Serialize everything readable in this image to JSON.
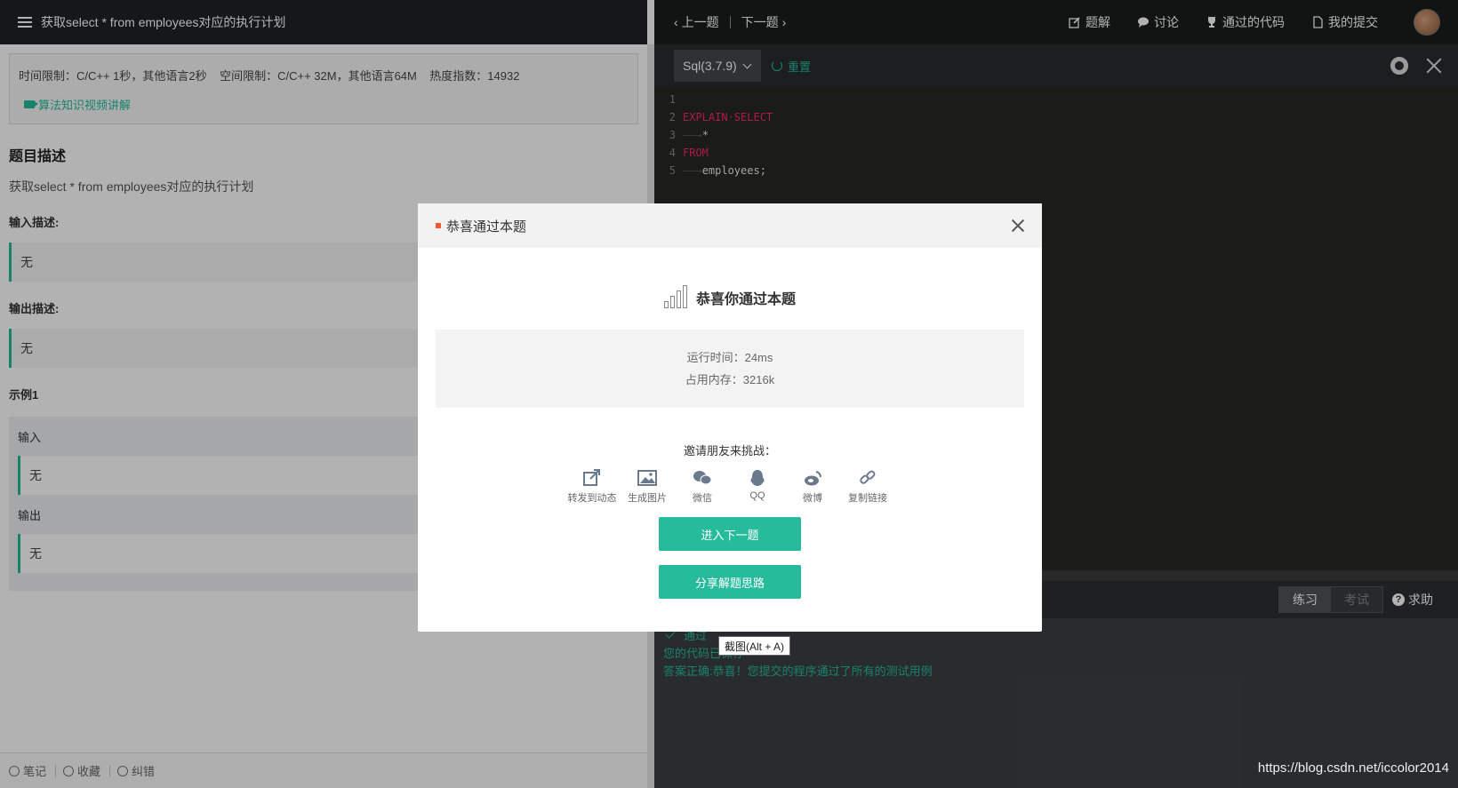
{
  "left": {
    "title": "获取select * from employees对应的执行计划",
    "limits": "时间限制：C/C++ 1秒，其他语言2秒    空间限制：C/C++ 32M，其他语言64M    热度指数：14932",
    "video_link": "算法知识视频讲解",
    "section_title": "题目描述",
    "description": "获取select * from employees对应的执行计划",
    "input_label": "输入描述:",
    "input_value": "无",
    "output_label": "输出描述:",
    "output_value": "无",
    "example_label": "示例1",
    "example_input_label": "输入",
    "example_input_value": "无",
    "example_output_label": "输出",
    "example_output_value": "无",
    "footer": [
      "笔记",
      "收藏",
      "纠错"
    ]
  },
  "right": {
    "prev": "上一题",
    "next": "下一题",
    "links": [
      {
        "label": "题解",
        "icon": "edit-icon"
      },
      {
        "label": "讨论",
        "icon": "chat-icon"
      },
      {
        "label": "通过的代码",
        "icon": "trophy-icon"
      },
      {
        "label": "我的提交",
        "icon": "document-icon"
      }
    ],
    "language": "Sql(3.7.9)",
    "reset": "重置",
    "code": [
      {
        "n": "1",
        "parts": []
      },
      {
        "n": "2",
        "parts": [
          {
            "t": "EXPLAIN·SELECT",
            "c": "kw"
          }
        ]
      },
      {
        "n": "3",
        "parts": [
          {
            "t": "——→",
            "c": "indent"
          },
          {
            "t": "*",
            "c": "plain"
          }
        ]
      },
      {
        "n": "4",
        "parts": [
          {
            "t": "FROM",
            "c": "kw"
          }
        ]
      },
      {
        "n": "5",
        "parts": [
          {
            "t": "——→",
            "c": "indent"
          },
          {
            "t": "employees;",
            "c": "plain"
          }
        ]
      }
    ],
    "mode_practice": "练习",
    "mode_exam": "考试",
    "help": "求助",
    "result_pass": "通过",
    "result_saved": "您的代码已保存",
    "result_msg": "答案正确:恭喜！您提交的程序通过了所有的测试用例",
    "tooltip": "截图(Alt + A)",
    "watermark": "https://blog.csdn.net/iccolor2014"
  },
  "modal": {
    "title": "恭喜通过本题",
    "success_text": "恭喜你通过本题",
    "run_time": "运行时间：24ms",
    "memory": "占用内存：3216k",
    "invite": "邀请朋友来挑战：",
    "share": [
      {
        "label": "转发到动态",
        "icon": "share-external-icon"
      },
      {
        "label": "生成图片",
        "icon": "image-icon"
      },
      {
        "label": "微信",
        "icon": "wechat-icon"
      },
      {
        "label": "QQ",
        "icon": "qq-icon"
      },
      {
        "label": "微博",
        "icon": "weibo-icon"
      },
      {
        "label": "复制链接",
        "icon": "link-icon"
      }
    ],
    "next_button": "进入下一题",
    "share_button": "分享解题思路"
  },
  "colors": {
    "accent": "#25bb9b",
    "modal_dot": "#f6572d",
    "header_bg": "#1f2327",
    "editor_bg": "#272822",
    "keyword": "#f92672"
  }
}
